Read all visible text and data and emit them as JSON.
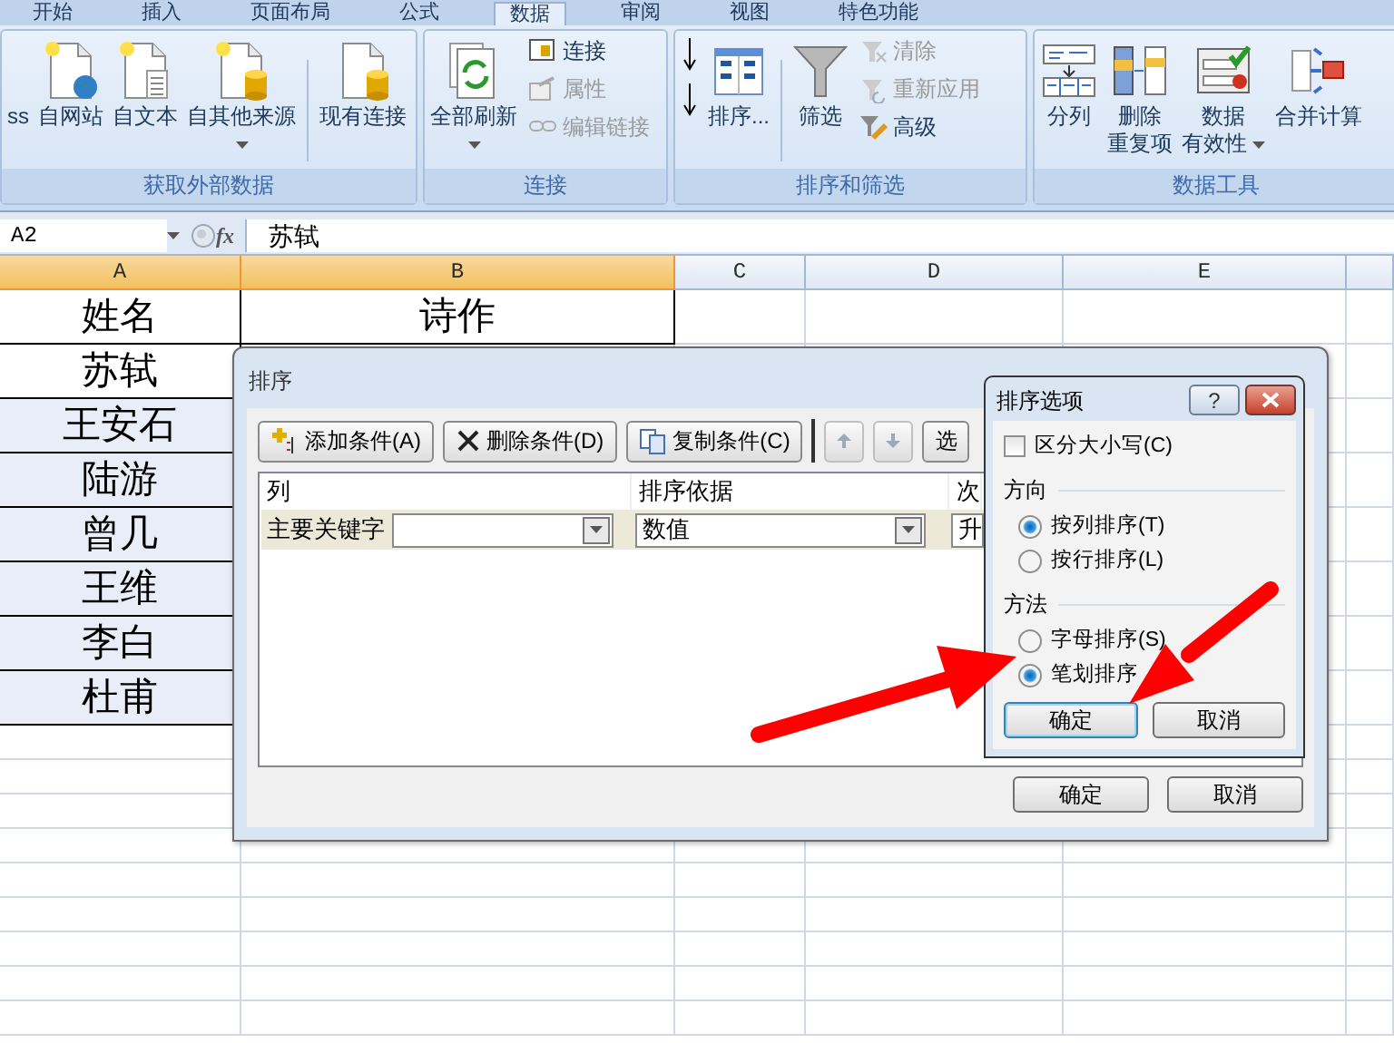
{
  "ribbon": {
    "tabs": [
      {
        "label": "开始",
        "selected": false
      },
      {
        "label": "插入",
        "selected": false
      },
      {
        "label": "页面布局",
        "selected": false
      },
      {
        "label": "公式",
        "selected": false
      },
      {
        "label": "数据",
        "selected": true
      },
      {
        "label": "审阅",
        "selected": false
      },
      {
        "label": "视图",
        "selected": false
      },
      {
        "label": "特色功能",
        "selected": false
      }
    ],
    "groups": [
      {
        "title": "获取外部数据",
        "columns": [
          [
            {
              "kind": "large",
              "lines": [
                "ss"
              ],
              "dropdown": false
            }
          ],
          [
            {
              "kind": "large",
              "lines": [
                "自网站"
              ],
              "dropdown": false
            }
          ],
          [
            {
              "kind": "large",
              "lines": [
                "自文本"
              ],
              "dropdown": false
            }
          ],
          [
            {
              "kind": "large",
              "lines": [
                "自其他来源"
              ],
              "dropdown": true
            }
          ],
          [
            {
              "kind": "separator"
            }
          ],
          [
            {
              "kind": "large",
              "lines": [
                "现有连接"
              ],
              "dropdown": false
            }
          ]
        ]
      },
      {
        "title": "连接",
        "columns": [
          [
            {
              "kind": "large",
              "lines": [
                "全部刷新"
              ],
              "dropdown": true
            }
          ],
          [
            {
              "kind": "small",
              "label": "连接",
              "disabled": false
            },
            {
              "kind": "small",
              "label": "属性",
              "disabled": true
            },
            {
              "kind": "small",
              "label": "编辑链接",
              "disabled": true
            }
          ]
        ]
      },
      {
        "title": "排序和筛选",
        "columns": [
          [
            {
              "kind": "icon"
            },
            {
              "kind": "icon"
            }
          ],
          [
            {
              "kind": "large",
              "lines": [
                "排序..."
              ],
              "dropdown": false
            }
          ],
          [
            {
              "kind": "separator"
            }
          ],
          [
            {
              "kind": "large",
              "lines": [
                "筛选"
              ],
              "dropdown": false
            }
          ],
          [
            {
              "kind": "small",
              "label": "清除",
              "disabled": true
            },
            {
              "kind": "small",
              "label": "重新应用",
              "disabled": true
            },
            {
              "kind": "small",
              "label": "高级",
              "disabled": false
            }
          ]
        ]
      },
      {
        "title": "数据工具",
        "columns": [
          [
            {
              "kind": "large",
              "lines": [
                "分列"
              ],
              "dropdown": false
            }
          ],
          [
            {
              "kind": "large",
              "lines": [
                "删除",
                "重复项"
              ],
              "dropdown": false
            }
          ],
          [
            {
              "kind": "large",
              "lines": [
                "数据",
                "有效性"
              ],
              "dropdown": true
            }
          ],
          [
            {
              "kind": "large",
              "lines": [
                "合并计算"
              ],
              "dropdown": false
            }
          ]
        ]
      }
    ]
  },
  "formula_bar": {
    "name_box": "A2",
    "fx": "fx",
    "content": "苏轼"
  },
  "sheet": {
    "columns": [
      {
        "label": "A",
        "selected": true
      },
      {
        "label": "B",
        "selected": true
      },
      {
        "label": "C",
        "selected": false
      },
      {
        "label": "D",
        "selected": false
      },
      {
        "label": "E",
        "selected": false
      }
    ],
    "rows": [
      {
        "cells": [
          {
            "text": "姓名",
            "highlighted": false
          },
          {
            "text": "诗作",
            "highlighted": false
          }
        ]
      },
      {
        "cells": [
          {
            "text": "苏轼",
            "highlighted": false
          }
        ]
      },
      {
        "cells": [
          {
            "text": "王安石",
            "highlighted": true
          }
        ]
      },
      {
        "cells": [
          {
            "text": "陆游",
            "highlighted": true
          }
        ]
      },
      {
        "cells": [
          {
            "text": "曾几",
            "highlighted": true
          }
        ]
      },
      {
        "cells": [
          {
            "text": "王维",
            "highlighted": true
          }
        ]
      },
      {
        "cells": [
          {
            "text": "李白",
            "highlighted": true
          }
        ]
      },
      {
        "cells": [
          {
            "text": "杜甫",
            "highlighted": true
          }
        ]
      }
    ]
  },
  "sort_dialog": {
    "title": "排序",
    "toolbar": [
      {
        "kind": "button",
        "label": "添加条件(A)"
      },
      {
        "kind": "button",
        "label": "删除条件(D)"
      },
      {
        "kind": "button",
        "label": "复制条件(C)"
      },
      {
        "kind": "arrow"
      },
      {
        "kind": "arrow"
      },
      {
        "kind": "button",
        "label": "选"
      }
    ],
    "columns": [
      "列",
      "排序依据",
      "次"
    ],
    "rows": [
      {
        "label": "主要关键字",
        "basis": "数值",
        "order": "升"
      }
    ],
    "buttons": [
      "确定",
      "取消"
    ]
  },
  "options_dialog": {
    "title": "排序选项",
    "help": "?",
    "case_sensitive": {
      "label": "区分大小写(C)",
      "checked": false
    },
    "sections": [
      {
        "title": "方向",
        "options": [
          {
            "label": "按列排序(T)",
            "selected": true
          },
          {
            "label": "按行排序(L)",
            "selected": false
          }
        ]
      },
      {
        "title": "方法",
        "options": [
          {
            "label": "字母排序(S)",
            "selected": false
          },
          {
            "label": "笔划排序",
            "selected": true
          }
        ]
      }
    ],
    "buttons": [
      {
        "label": "确定",
        "focused": true
      },
      {
        "label": "取消",
        "focused": false
      }
    ]
  }
}
